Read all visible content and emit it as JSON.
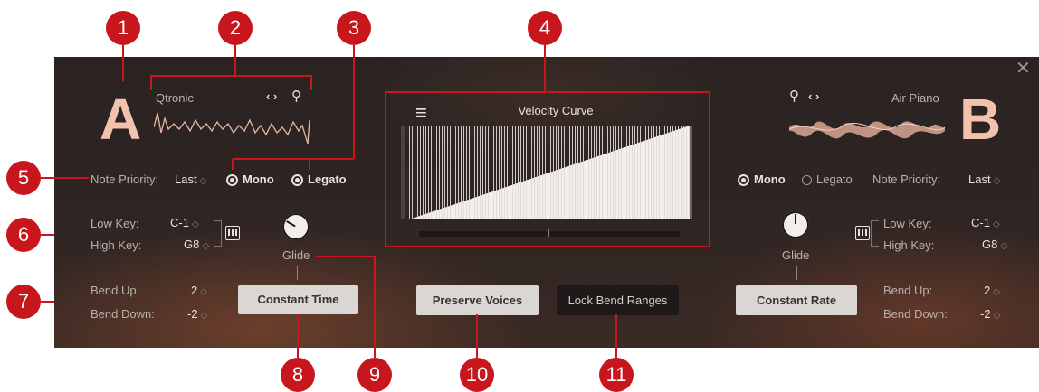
{
  "markers": [
    "1",
    "2",
    "3",
    "4",
    "5",
    "6",
    "7",
    "8",
    "9",
    "10",
    "11"
  ],
  "close_glyph": "✕",
  "slot_a": {
    "letter": "A",
    "instrument": "Qtronic",
    "nav_glyph": "‹ ›",
    "search_glyph": "⚲",
    "note_priority_label": "Note Priority:",
    "note_priority_value": "Last",
    "mono_label": "Mono",
    "legato_label": "Legato",
    "low_key_label": "Low Key:",
    "low_key_value": "C-1",
    "high_key_label": "High Key:",
    "high_key_value": "G8",
    "glide_label": "Glide",
    "bend_up_label": "Bend Up:",
    "bend_up_value": "2",
    "bend_down_label": "Bend Down:",
    "bend_down_value": "-2",
    "glide_mode_button": "Constant Time"
  },
  "slot_b": {
    "letter": "B",
    "instrument": "Air Piano",
    "nav_glyph": "‹ ›",
    "search_glyph": "⚲",
    "note_priority_label": "Note Priority:",
    "note_priority_value": "Last",
    "mono_label": "Mono",
    "legato_label": "Legato",
    "low_key_label": "Low Key:",
    "low_key_value": "C-1",
    "high_key_label": "High Key:",
    "high_key_value": "G8",
    "glide_label": "Glide",
    "bend_up_label": "Bend Up:",
    "bend_up_value": "2",
    "bend_down_label": "Bend Down:",
    "bend_down_value": "-2",
    "glide_mode_button": "Constant Rate"
  },
  "velocity": {
    "title": "Velocity Curve",
    "menu_glyph": "≡"
  },
  "center": {
    "preserve_voices_button": "Preserve Voices",
    "lock_bend_ranges_button": "Lock Bend Ranges"
  },
  "stepper_glyph": "◇",
  "colors": {
    "marker": "#c8161d",
    "accent_letter": "#f3c2ae",
    "panel_bg": "#2c2422"
  }
}
